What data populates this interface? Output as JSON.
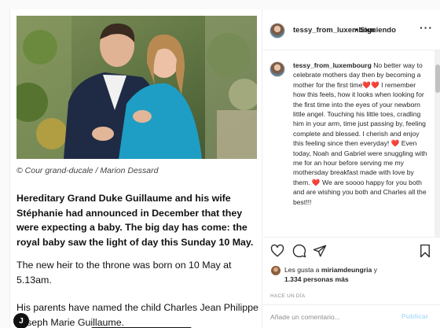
{
  "article": {
    "caption": "© Cour grand-ducale / Marion Dessard",
    "lead": "Hereditary Grand Duke Guillaume and his wife Stéphanie had announced in December that they were expecting a baby. The big day has come: the royal baby saw the light of day this Sunday 10 May.",
    "paragraph_2": "The new heir to the throne was born on 10 May at 5.13am.",
    "paragraph_3": "His parents have named the child Charles Jean Philippe Joseph Marie Guillaume.",
    "logo_letter": "J"
  },
  "header": {
    "username": "tessy_from_luxembour",
    "separator": "•",
    "follow_state": "Siguiendo",
    "more_glyph": "···"
  },
  "comment": {
    "username": "tessy_from_luxembourg",
    "text_before_hearts": " No better way to celebrate mothers day then by becoming a mother for the first time",
    "hearts_1": "❤️❤️",
    "text_2": "I remember how this feels, how it looks when looking for the first time into the eyes of your newborn little angel. Touching his little toes, cradling him in your arm, time just passing by, feeling complete and blessed. I cherish and enjoy this feeling since then everyday!",
    "heart_2": "❤️",
    "text_3": "Even today, Noah and Gabriel were snuggling with me for an hour before serving me my mothersday breakfast made with love by them.",
    "heart_3": "❤️",
    "text_4": "We are soooo happy for you both and are wishing you both and Charles all the best!!!"
  },
  "likes": {
    "prefix": "Les gusta a ",
    "user": "miriamdeungria",
    "suffix": " y",
    "count": "1.334 personas más"
  },
  "timestamp": "HACE UN DÍA",
  "add_comment": {
    "placeholder": "Añade un comentario...",
    "publish_label": "Publicar"
  },
  "icons": {
    "like": "heart-outline-icon",
    "comment": "speech-bubble-icon",
    "share": "paper-plane-icon",
    "save": "bookmark-icon",
    "more": "ellipsis-icon"
  },
  "colors": {
    "publish_disabled": "#b2dffc",
    "heart_red": "#ed4956",
    "muted_text": "#8e8e8e"
  }
}
